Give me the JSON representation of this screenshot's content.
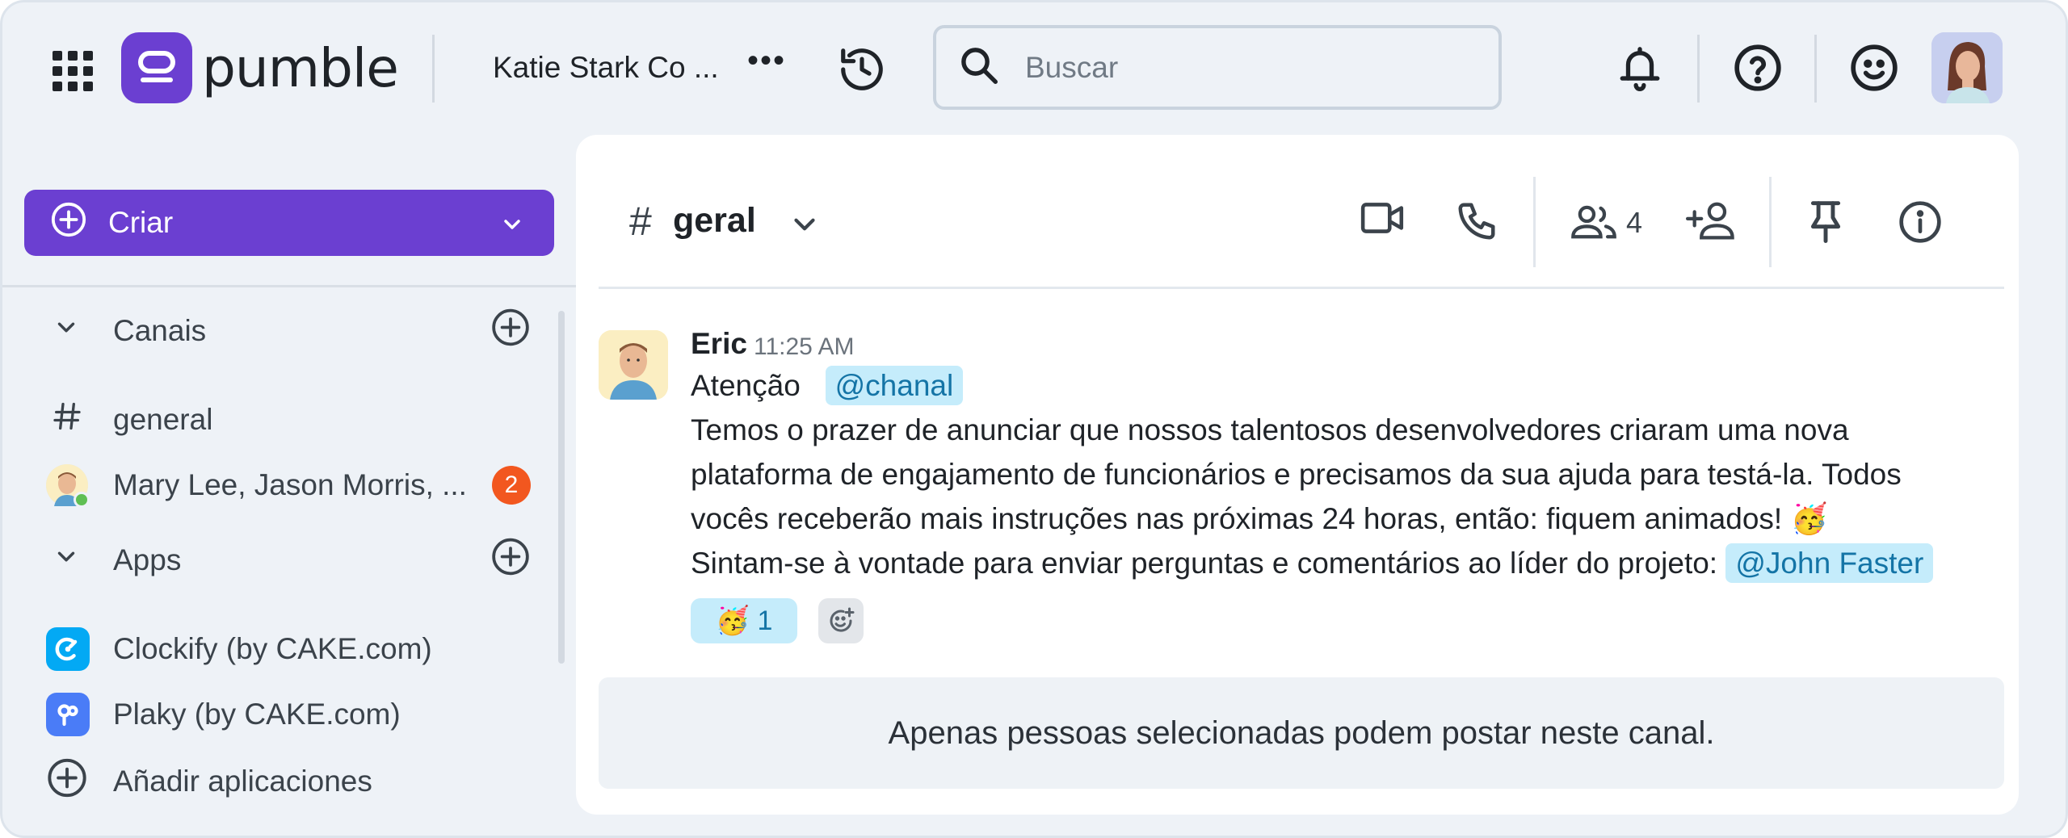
{
  "app": {
    "brand": "pumble",
    "workspace_name": "Katie Stark Co ...",
    "more_glyph": "•••"
  },
  "search": {
    "placeholder": "Buscar",
    "value": ""
  },
  "sidebar": {
    "create_label": "Criar",
    "sections": {
      "channels_label": "Canais",
      "apps_label": "Apps"
    },
    "channels": [
      {
        "label": "general",
        "icon": "hash-icon"
      }
    ],
    "dms": [
      {
        "label": "Mary Lee, Jason Morris, ...",
        "unread": "2"
      }
    ],
    "apps": [
      {
        "label": "Clockify (by CAKE.com)",
        "color": "#03a9f4"
      },
      {
        "label": "Plaky (by CAKE.com)",
        "color": "#4a7cf7"
      }
    ],
    "add_apps_label": "Añadir aplicaciones"
  },
  "channel": {
    "hash": "#",
    "name": "geral",
    "member_count": "4"
  },
  "message": {
    "author": "Eric",
    "time": "11:25 AM",
    "line1_text": "Atenção",
    "line1_mention": "@chanal",
    "line2": "Temos o prazer de anunciar que nossos talentosos desenvolvedores criaram uma nova",
    "line3": "plataforma de engajamento de funcionários e precisamos da sua ajuda para testá-la. Todos",
    "line4": "vocês receberão mais instruções nas próximas 24 horas, então: fiquem animados! 🥳",
    "line5_text": "Sintam-se à vontade para enviar perguntas e comentários ao líder do projeto:",
    "line5_mention": "@John Faster",
    "reaction_emoji": "🥳",
    "reaction_count": "1"
  },
  "notice": "Apenas pessoas selecionadas podem postar neste canal.",
  "colors": {
    "brand": "#6b3fd1",
    "badge": "#f2571f",
    "mention_bg": "#c5ecfb",
    "mention_text": "#1474a6"
  }
}
